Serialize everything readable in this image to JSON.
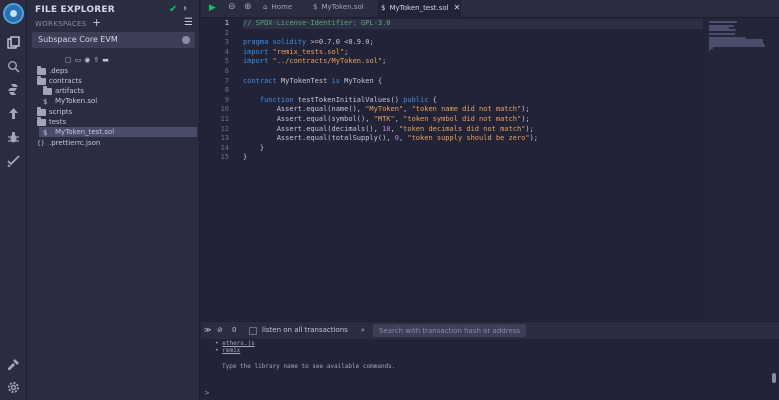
{
  "colors": {
    "accent": "#00c26a",
    "keyword": "#3a8ee6",
    "string": "#e8a25a",
    "comment": "#57a96f",
    "number": "#b58cd9"
  },
  "explorer": {
    "title": "FILE EXPLORER",
    "workspaces_label": "WORKSPACES",
    "selected_workspace": "Subspace Core EVM",
    "tree": [
      {
        "name": ".deps",
        "type": "folder",
        "depth": 0
      },
      {
        "name": "contracts",
        "type": "folder",
        "depth": 0
      },
      {
        "name": "artifacts",
        "type": "folder",
        "depth": 1
      },
      {
        "name": "MyToken.sol",
        "type": "file",
        "depth": 1
      },
      {
        "name": "scripts",
        "type": "folder",
        "depth": 0
      },
      {
        "name": "tests",
        "type": "folder",
        "depth": 0
      },
      {
        "name": "MyToken_test.sol",
        "type": "file",
        "depth": 1,
        "selected": true
      },
      {
        "name": ".prettierrc.json",
        "type": "json",
        "depth": 0
      }
    ]
  },
  "tabs": {
    "home": "Home",
    "file1": "MyToken.sol",
    "file2": "MyToken_test.sol"
  },
  "editor": {
    "current_line": 1,
    "lines": [
      [
        [
          "c-com",
          "// SPDX-License-Identifier: GPL-3.0"
        ]
      ],
      [],
      [
        [
          "c-kw",
          "pragma"
        ],
        [
          "c-id",
          " "
        ],
        [
          "c-kw",
          "solidity"
        ],
        [
          "c-id",
          " >=0.7.0 <0.9.0;"
        ]
      ],
      [
        [
          "c-kw",
          "import"
        ],
        [
          "c-id",
          " "
        ],
        [
          "c-str",
          "\"remix_tests.sol\""
        ],
        [
          "c-id",
          ";"
        ]
      ],
      [
        [
          "c-kw",
          "import"
        ],
        [
          "c-id",
          " "
        ],
        [
          "c-str",
          "\"../contracts/MyToken.sol\""
        ],
        [
          "c-id",
          ";"
        ]
      ],
      [],
      [
        [
          "c-kw",
          "contract"
        ],
        [
          "c-id",
          " MyTokenTest "
        ],
        [
          "c-kw",
          "is"
        ],
        [
          "c-id",
          " MyToken {"
        ]
      ],
      [],
      [
        [
          "c-id",
          "    "
        ],
        [
          "c-kw",
          "function"
        ],
        [
          "c-id",
          " testTokenInitialValues() "
        ],
        [
          "c-kw",
          "public"
        ],
        [
          "c-id",
          " {"
        ]
      ],
      [
        [
          "c-id",
          "        Assert.equal(name(), "
        ],
        [
          "c-str",
          "\"MyToken\""
        ],
        [
          "c-id",
          ", "
        ],
        [
          "c-str",
          "\"token name did not match\""
        ],
        [
          "c-id",
          ");"
        ]
      ],
      [
        [
          "c-id",
          "        Assert.equal(symbol(), "
        ],
        [
          "c-str",
          "\"MTK\""
        ],
        [
          "c-id",
          ", "
        ],
        [
          "c-str",
          "\"token symbol did not match\""
        ],
        [
          "c-id",
          ");"
        ]
      ],
      [
        [
          "c-id",
          "        Assert.equal(decimals(), "
        ],
        [
          "c-num",
          "18"
        ],
        [
          "c-id",
          ", "
        ],
        [
          "c-str",
          "\"token decimals did not match\""
        ],
        [
          "c-id",
          ");"
        ]
      ],
      [
        [
          "c-id",
          "        Assert.equal(totalSupply(), "
        ],
        [
          "c-num",
          "0"
        ],
        [
          "c-id",
          ", "
        ],
        [
          "c-str",
          "\"token supply should be zero\""
        ],
        [
          "c-id",
          ");"
        ]
      ],
      [
        [
          "c-id",
          "    }"
        ]
      ],
      [
        [
          "c-id",
          "}"
        ]
      ]
    ]
  },
  "terminal": {
    "pending_count": "0",
    "listen_label": "listen on all transactions",
    "search_placeholder": "Search with transaction hash or address",
    "lib_lines": [
      "ethers.js",
      "remix"
    ],
    "hint": "Type the library name to see available commands.",
    "prompt": ">"
  }
}
